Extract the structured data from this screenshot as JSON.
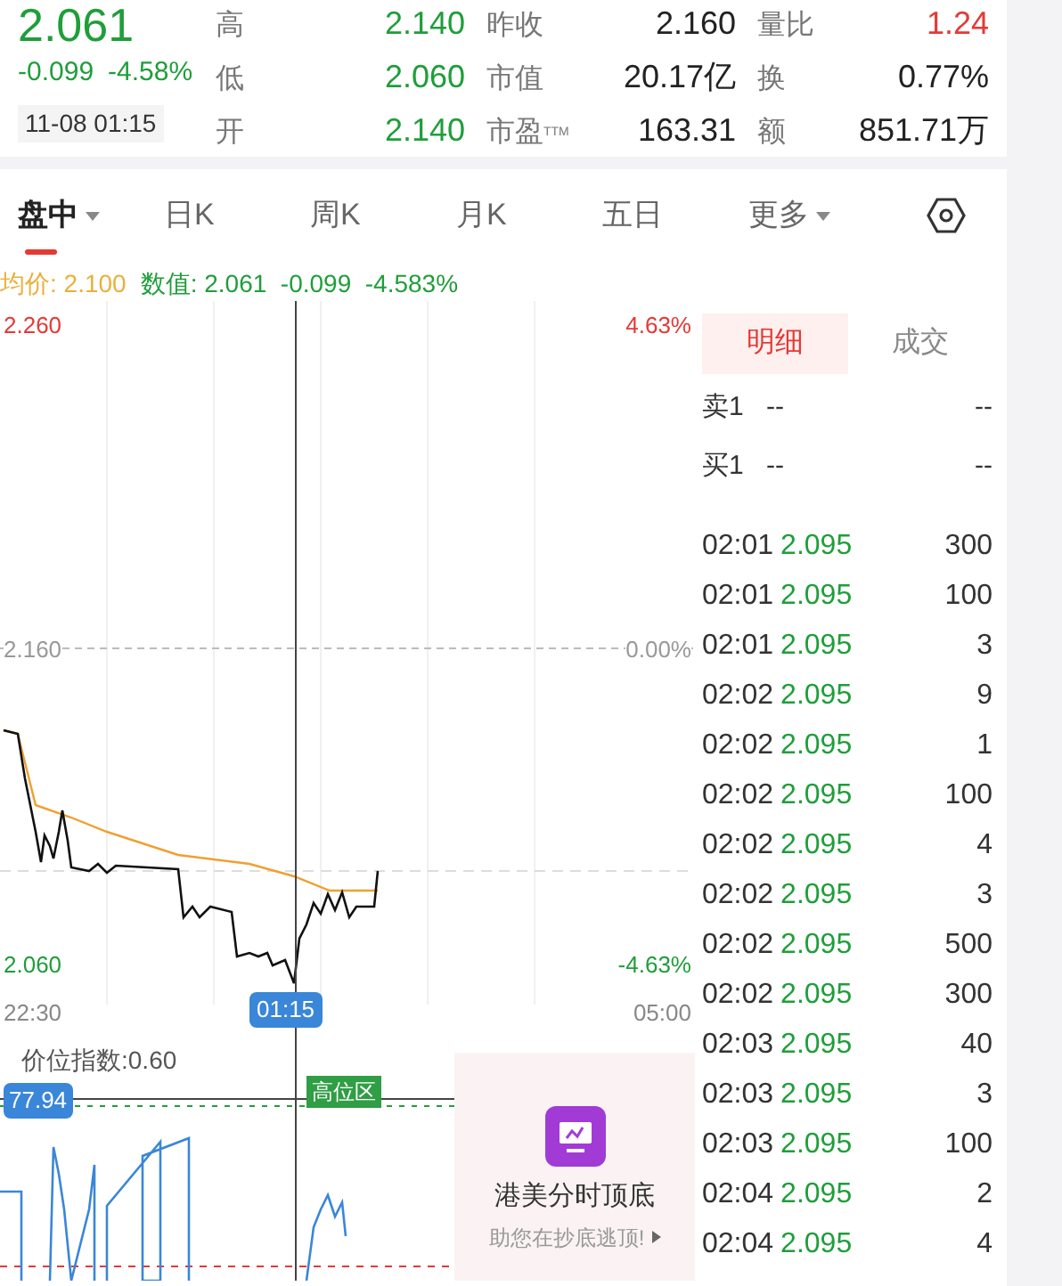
{
  "quote": {
    "price": "2.061",
    "change": "-0.099",
    "change_pct": "-4.58%",
    "time": "11-08 01:15"
  },
  "stats": [
    {
      "label": "高",
      "value": "2.140",
      "color": "#1f9e3a"
    },
    {
      "label": "昨收",
      "value": "2.160",
      "color": "#222222"
    },
    {
      "label": "量比",
      "value": "1.24",
      "color": "#e53935"
    },
    {
      "label": "低",
      "value": "2.060",
      "color": "#1f9e3a"
    },
    {
      "label": "市值",
      "value": "20.17亿",
      "color": "#222222"
    },
    {
      "label": "换",
      "value": "0.77%",
      "color": "#222222"
    },
    {
      "label": "开",
      "value": "2.140",
      "color": "#1f9e3a"
    },
    {
      "label": "市盈$^{TTM}$",
      "value": "163.31",
      "color": "#222222"
    },
    {
      "label": "额",
      "value": "851.71万",
      "color": "#222222"
    }
  ],
  "tabs": [
    {
      "label": "盘中",
      "selected": true,
      "dropdown": true
    },
    {
      "label": "日K",
      "selected": false,
      "dropdown": false
    },
    {
      "label": "周K",
      "selected": false,
      "dropdown": false
    },
    {
      "label": "月K",
      "selected": false,
      "dropdown": false
    },
    {
      "label": "五日",
      "selected": false,
      "dropdown": false
    },
    {
      "label": "更多",
      "selected": false,
      "dropdown": true
    }
  ],
  "legend": {
    "average": "均价: 2.100",
    "value": "数值: 2.061  -0.099  -4.583%"
  },
  "chart": {
    "y_high": "2.260",
    "y_mid": "2.160",
    "y_low": "2.060",
    "pct_high": "4.63%",
    "pct_mid": "0.00%",
    "pct_low": "-4.63%",
    "time_start": "22:30",
    "time_cursor": "01:15",
    "time_end": "05:00"
  },
  "indicator": {
    "title": "价位指数:0.60",
    "cursor_value": "77.94",
    "zone": "高位区"
  },
  "promo": {
    "title": "港美分时顶底",
    "subtitle": "助您在抄底逃顶!"
  },
  "detail_tabs": [
    {
      "label": "明细",
      "selected": true
    },
    {
      "label": "成交",
      "selected": false
    }
  ],
  "order_book": [
    {
      "side": "卖1",
      "price": "--",
      "volume": "--"
    },
    {
      "side": "买1",
      "price": "--",
      "volume": "--"
    }
  ],
  "trades": [
    {
      "time": "02:01",
      "price": "2.095",
      "volume": "300"
    },
    {
      "time": "02:01",
      "price": "2.095",
      "volume": "100"
    },
    {
      "time": "02:01",
      "price": "2.095",
      "volume": "3"
    },
    {
      "time": "02:02",
      "price": "2.095",
      "volume": "9"
    },
    {
      "time": "02:02",
      "price": "2.095",
      "volume": "1"
    },
    {
      "time": "02:02",
      "price": "2.095",
      "volume": "100"
    },
    {
      "time": "02:02",
      "price": "2.095",
      "volume": "4"
    },
    {
      "time": "02:02",
      "price": "2.095",
      "volume": "3"
    },
    {
      "time": "02:02",
      "price": "2.095",
      "volume": "500"
    },
    {
      "time": "02:02",
      "price": "2.095",
      "volume": "300"
    },
    {
      "time": "02:03",
      "price": "2.095",
      "volume": "40"
    },
    {
      "time": "02:03",
      "price": "2.095",
      "volume": "3"
    },
    {
      "time": "02:03",
      "price": "2.095",
      "volume": "100"
    },
    {
      "time": "02:04",
      "price": "2.095",
      "volume": "2"
    },
    {
      "time": "02:04",
      "price": "2.095",
      "volume": "4"
    }
  ]
}
